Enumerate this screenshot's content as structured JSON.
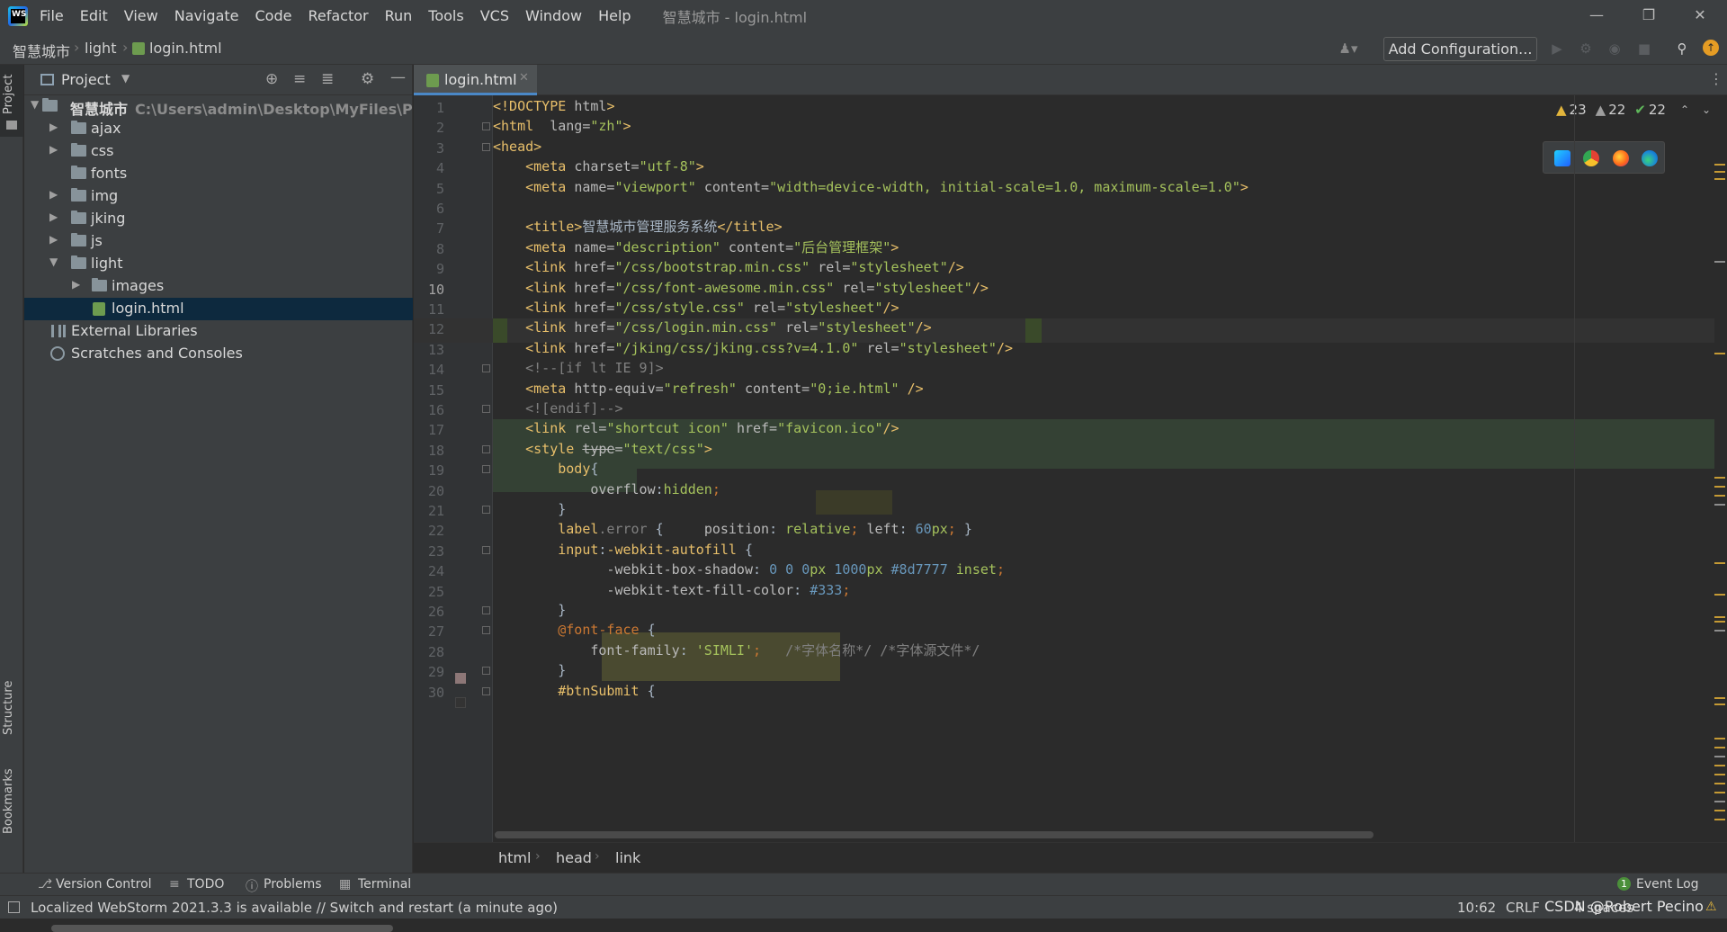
{
  "menubar": {
    "logo_text": "WS",
    "items": [
      "File",
      "Edit",
      "View",
      "Navigate",
      "Code",
      "Refactor",
      "Run",
      "Tools",
      "VCS",
      "Window",
      "Help"
    ],
    "window_title": "智慧城市 - login.html"
  },
  "navbar": {
    "crumbs": [
      "智慧城市",
      "light",
      "login.html"
    ],
    "add_config_label": "Add Configuration..."
  },
  "side_tabs": {
    "project": "Project",
    "structure": "Structure",
    "bookmarks": "Bookmarks"
  },
  "project": {
    "title": "Project",
    "tree": [
      {
        "label": "智慧城市",
        "path": "C:\\Users\\admin\\Desktop\\MyFiles\\Project\\智",
        "bold": true
      },
      {
        "label": "ajax"
      },
      {
        "label": "css"
      },
      {
        "label": "fonts"
      },
      {
        "label": "img"
      },
      {
        "label": "jking"
      },
      {
        "label": "js"
      },
      {
        "label": "light"
      },
      {
        "label": "images"
      },
      {
        "label": "login.html"
      },
      {
        "label": "External Libraries"
      },
      {
        "label": "Scratches and Consoles"
      }
    ]
  },
  "editor": {
    "tab_label": "login.html",
    "inspections": {
      "warnings": "23",
      "weak_warnings": "22",
      "ok": "22"
    },
    "line_numbers": [
      "1",
      "2",
      "3",
      "4",
      "5",
      "6",
      "7",
      "8",
      "9",
      "10",
      "11",
      "12",
      "13",
      "14",
      "15",
      "16",
      "17",
      "18",
      "19",
      "20",
      "21",
      "22",
      "23",
      "24",
      "25",
      "26",
      "27",
      "28",
      "29",
      "30"
    ],
    "breadcrumbs": [
      "html",
      "head",
      "link"
    ]
  },
  "toolwindows": {
    "version_control": "Version Control",
    "todo": "TODO",
    "problems": "Problems",
    "terminal": "Terminal",
    "event_log": "Event Log",
    "event_count": "1"
  },
  "statusbar": {
    "message": "Localized WebStorm 2021.3.3 is available // Switch and restart (a minute ago)",
    "position": "10:62",
    "line_sep": "CRLF",
    "indent": "4 spaces",
    "watermark": "CSDN @Robert Pecino"
  },
  "colors": {
    "accent": "#4a88c7",
    "selection": "#0d293e",
    "bg_editor": "#2b2b2b",
    "bg_panel": "#3c3f41"
  }
}
